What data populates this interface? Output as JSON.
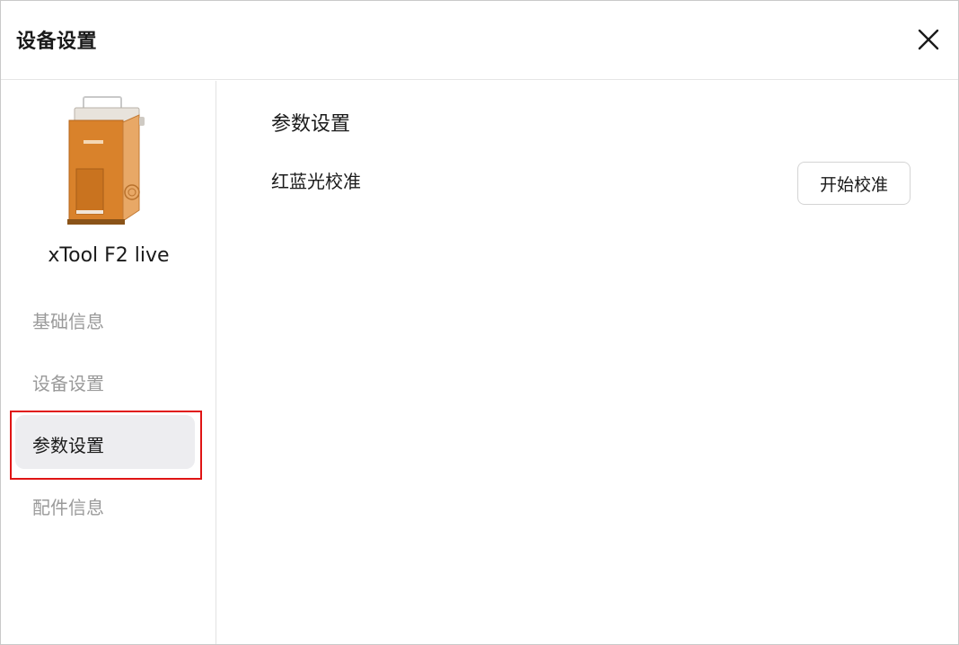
{
  "header": {
    "title": "设备设置",
    "close_icon": "close-icon"
  },
  "sidebar": {
    "device_name": "xTool F2 live",
    "device_image_icon": "laser-engraver-device-image",
    "items": [
      {
        "label": "基础信息",
        "active": false
      },
      {
        "label": "设备设置",
        "active": false
      },
      {
        "label": "参数设置",
        "active": true
      },
      {
        "label": "配件信息",
        "active": false
      }
    ]
  },
  "main": {
    "section_title": "参数设置",
    "settings": [
      {
        "label": "红蓝光校准",
        "button_label": "开始校准"
      }
    ]
  },
  "colors": {
    "accent_highlight": "#e01414",
    "active_item_bg": "#ededf0",
    "inactive_text": "#9a9a9a",
    "device_orange": "#d9822b"
  }
}
